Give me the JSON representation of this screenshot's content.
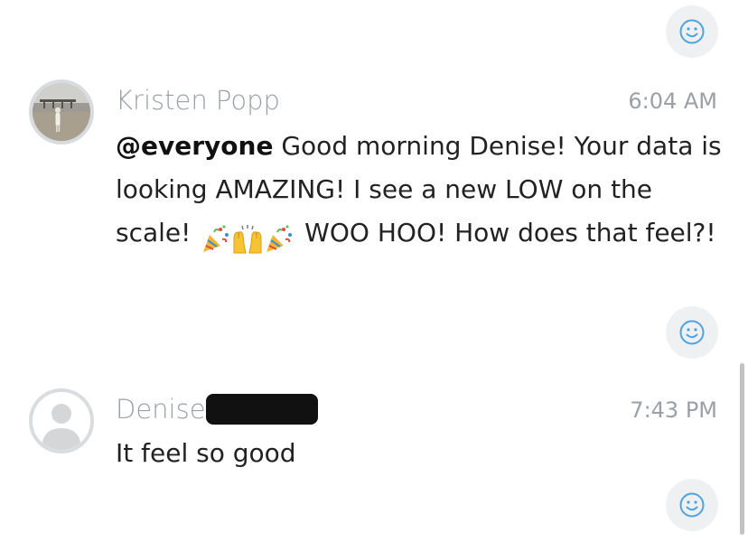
{
  "messages": [
    {
      "author": "Kristen Popp",
      "time": "6:04 AM",
      "mention": "@everyone",
      "text_part1": " Good morning Denise! Your data is looking AMAZING! I see a new LOW on the scale! ",
      "emojis": [
        "party-popper",
        "raised-hands",
        "party-popper"
      ],
      "text_part2": " WOO HOO! How does that feel?!"
    },
    {
      "author": "Denise",
      "author_redacted": true,
      "time": "7:43 PM",
      "text": "It feel so good"
    }
  ],
  "icons": {
    "reaction": "smiley-icon",
    "avatar_generic": "person-silhouette-icon"
  },
  "colors": {
    "reaction_bg": "#eef0f1",
    "reaction_icon": "#4fa3e0",
    "muted_text": "#9aa0a6",
    "body_text": "#222222"
  }
}
